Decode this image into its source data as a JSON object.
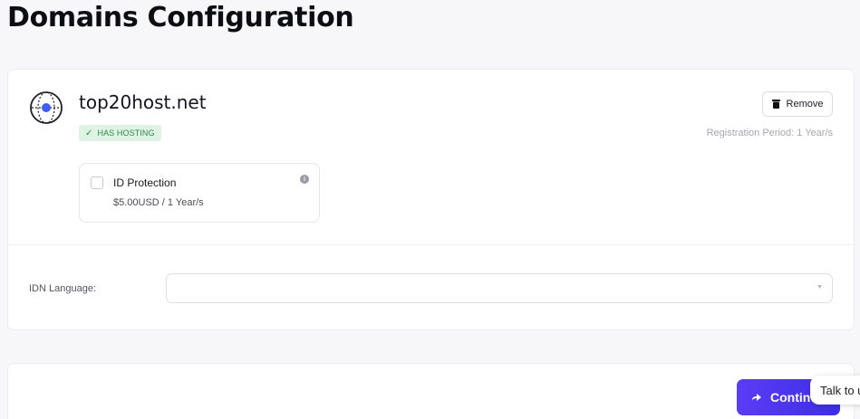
{
  "page": {
    "title": "Domains Configuration"
  },
  "domain": {
    "name": "top20host.net",
    "badge": "HAS HOSTING",
    "remove_label": "Remove",
    "registration_period": "Registration Period: 1 Year/s"
  },
  "addons": [
    {
      "title": "ID Protection",
      "price": "$5.00USD / 1 Year/s",
      "checked": false
    }
  ],
  "idn": {
    "label": "IDN Language:",
    "value": ""
  },
  "footer": {
    "continue_label": "Continue"
  },
  "chat": {
    "label": "Talk to us"
  },
  "colors": {
    "accent": "#4f35f2",
    "badge_bg": "#dff3e4",
    "badge_text": "#2f8a46"
  }
}
